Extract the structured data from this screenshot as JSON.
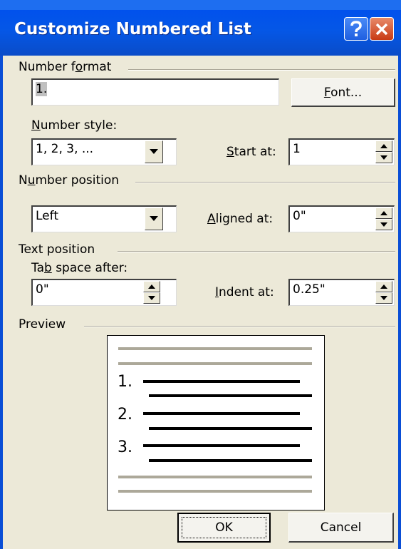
{
  "window": {
    "title": "Customize Numbered List"
  },
  "number_format": {
    "group_label_pre": "Number f",
    "group_label_key": "o",
    "group_label_post": "rmat",
    "value": "1.",
    "font_button_key": "F",
    "font_button_rest": "ont..."
  },
  "number_style": {
    "label_key": "N",
    "label_rest": "umber style:",
    "selected": "1, 2, 3, ...",
    "start_at_label_key": "S",
    "start_at_label_rest": "tart at:",
    "start_at_value": "1"
  },
  "number_position": {
    "group_label_pre": "N",
    "group_label_key": "u",
    "group_label_post": "mber position",
    "selected": "Left",
    "aligned_at_label_key": "A",
    "aligned_at_label_rest": "ligned at:",
    "aligned_at_value": "0\""
  },
  "text_position": {
    "group_label": "Text position",
    "tab_space_label_pre": "Ta",
    "tab_space_label_key": "b",
    "tab_space_label_post": " space after:",
    "tab_space_value": "0\"",
    "indent_at_label_key": "I",
    "indent_at_label_rest": "ndent at:",
    "indent_at_value": "0.25\""
  },
  "preview": {
    "group_label": "Preview",
    "numbers": [
      "1.",
      "2.",
      "3."
    ],
    "colors": {
      "gray_line": "#aca899",
      "text_line": "#000000"
    }
  },
  "buttons": {
    "ok": "OK",
    "cancel": "Cancel"
  },
  "colors": {
    "titlebar": "#0557e6",
    "face": "#ece9d8",
    "close_button": "#c83a14"
  }
}
